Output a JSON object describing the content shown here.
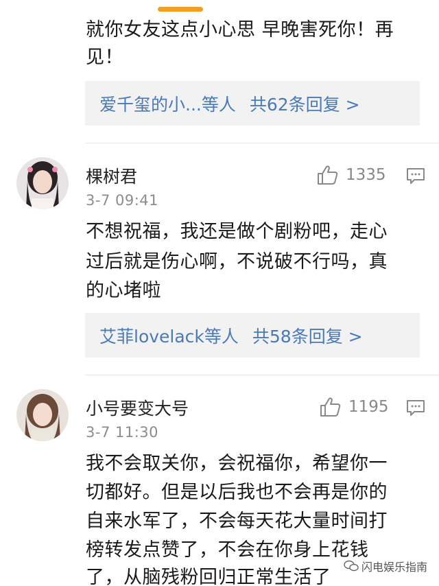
{
  "comments": [
    {
      "text_lines": [
        "就你女友这点小心思 早晚害死你！再",
        "见！"
      ],
      "replies": {
        "names": "爱千玺的小...等人",
        "total": "共62条回复 >"
      }
    },
    {
      "username": "棵树君",
      "time": "3-7 09:41",
      "likes": "1335",
      "text_lines": [
        "不想祝福，我还是做个剧粉吧，走心",
        "过后就是伤心啊，不说破不行吗，真",
        "的心堵啦"
      ],
      "replies": {
        "names": "艾菲lovelack等人",
        "total": "共58条回复 >"
      }
    },
    {
      "username": "小号要变大号",
      "time": "3-7 11:30",
      "likes": "1195",
      "text_lines": [
        "我不会取关你，会祝福你，希望你一",
        "切都好。但是以后我也不会再是你的",
        "自来水军了，不会每天花大量时间打",
        "榜转发点赞了，不会在你身上花钱",
        "了，从脑残粉回归正常生活了"
      ]
    }
  ],
  "watermark": "闪电娱乐指南",
  "colors": {
    "link": "#4a79b8",
    "reply_bg": "#f2f2f2",
    "handle": "#f0a020",
    "meta": "#8c8c8c"
  },
  "icons": [
    "thumbs-up-icon",
    "comment-icon",
    "avatar",
    "wechat-icon"
  ]
}
